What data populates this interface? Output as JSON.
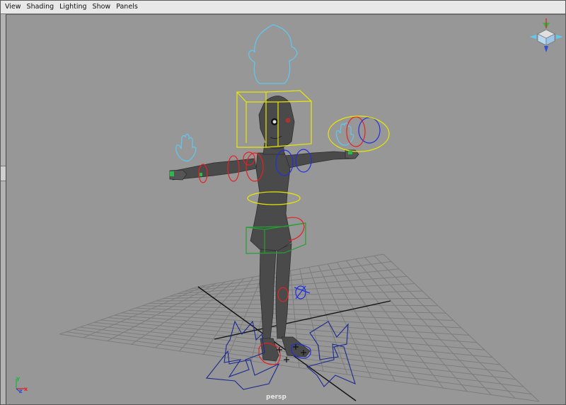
{
  "menubar": {
    "items": [
      {
        "label": "View"
      },
      {
        "label": "Shading"
      },
      {
        "label": "Lighting"
      },
      {
        "label": "Show"
      },
      {
        "label": "Panels"
      }
    ]
  },
  "viewport": {
    "camera_name": "persp",
    "background_color": "#979797",
    "grid_color": "#7d7d7d",
    "grid_axis_color": "#111111",
    "axis_indicator": {
      "x": "x",
      "y": "y",
      "z": "z"
    }
  },
  "scene": {
    "mesh_color": "#4a4a4a",
    "controls": {
      "head_shape_color": "#5fc8f0",
      "box_color": "#e8e800",
      "left_side_color": "#e82020",
      "right_side_color": "#2030e0",
      "root_color": "#1a2a90",
      "center_color": "#e8e800",
      "pelvis_box_color": "#22a030"
    }
  }
}
